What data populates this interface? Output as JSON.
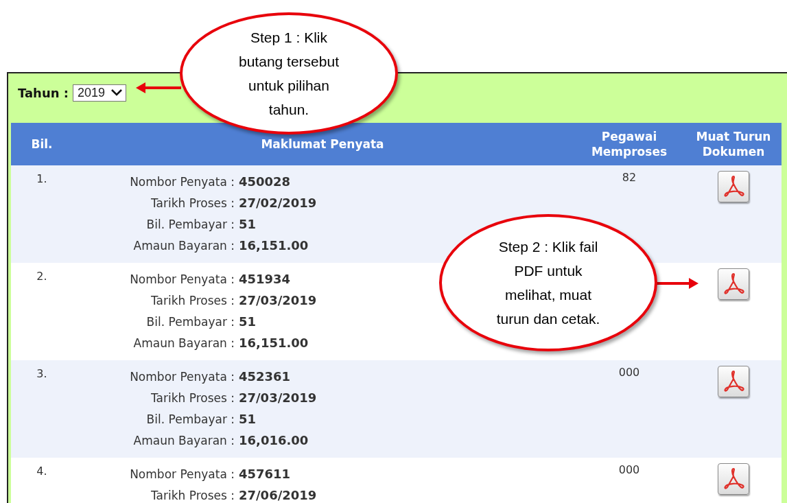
{
  "filter": {
    "label": "Tahun :",
    "value": "2019"
  },
  "table": {
    "columns": [
      "Bil.",
      "Maklumat Penyata",
      "Pegawai Memproses",
      "Muat Turun Dokumen"
    ],
    "rows": [
      {
        "number": "1.",
        "details": [
          {
            "label": "Nombor Penyata :",
            "value": "450028"
          },
          {
            "label": "Tarikh Proses :",
            "value": "27/02/2019"
          },
          {
            "label": "Bil. Pembayar :",
            "value": "51"
          },
          {
            "label": "Amaun Bayaran :",
            "value": "16,151.00"
          }
        ],
        "officer": "82"
      },
      {
        "number": "2.",
        "details": [
          {
            "label": "Nombor Penyata :",
            "value": "451934"
          },
          {
            "label": "Tarikh Proses :",
            "value": "27/03/2019"
          },
          {
            "label": "Bil. Pembayar :",
            "value": "51"
          },
          {
            "label": "Amaun Bayaran :",
            "value": "16,151.00"
          }
        ]
      },
      {
        "number": "3.",
        "details": [
          {
            "label": "Nombor Penyata :",
            "value": "452361"
          },
          {
            "label": "Tarikh Proses :",
            "value": "27/03/2019"
          },
          {
            "label": "Bil. Pembayar :",
            "value": "51"
          },
          {
            "label": "Amaun Bayaran :",
            "value": "16,016.00"
          }
        ],
        "officer": "000"
      },
      {
        "number": "4.",
        "details": [
          {
            "label": "Nombor Penyata :",
            "value": "457611"
          },
          {
            "label": "Tarikh Proses :",
            "value": "27/06/2019"
          }
        ],
        "officer": "000"
      }
    ]
  },
  "callouts": [
    {
      "lines": [
        "Step 1 : Klik",
        "butang tersebut",
        "untuk pilihan",
        "tahun."
      ]
    },
    {
      "lines": [
        "Step 2 : Klik fail",
        "PDF untuk",
        "melihat, muat",
        "turun dan cetak."
      ]
    }
  ]
}
